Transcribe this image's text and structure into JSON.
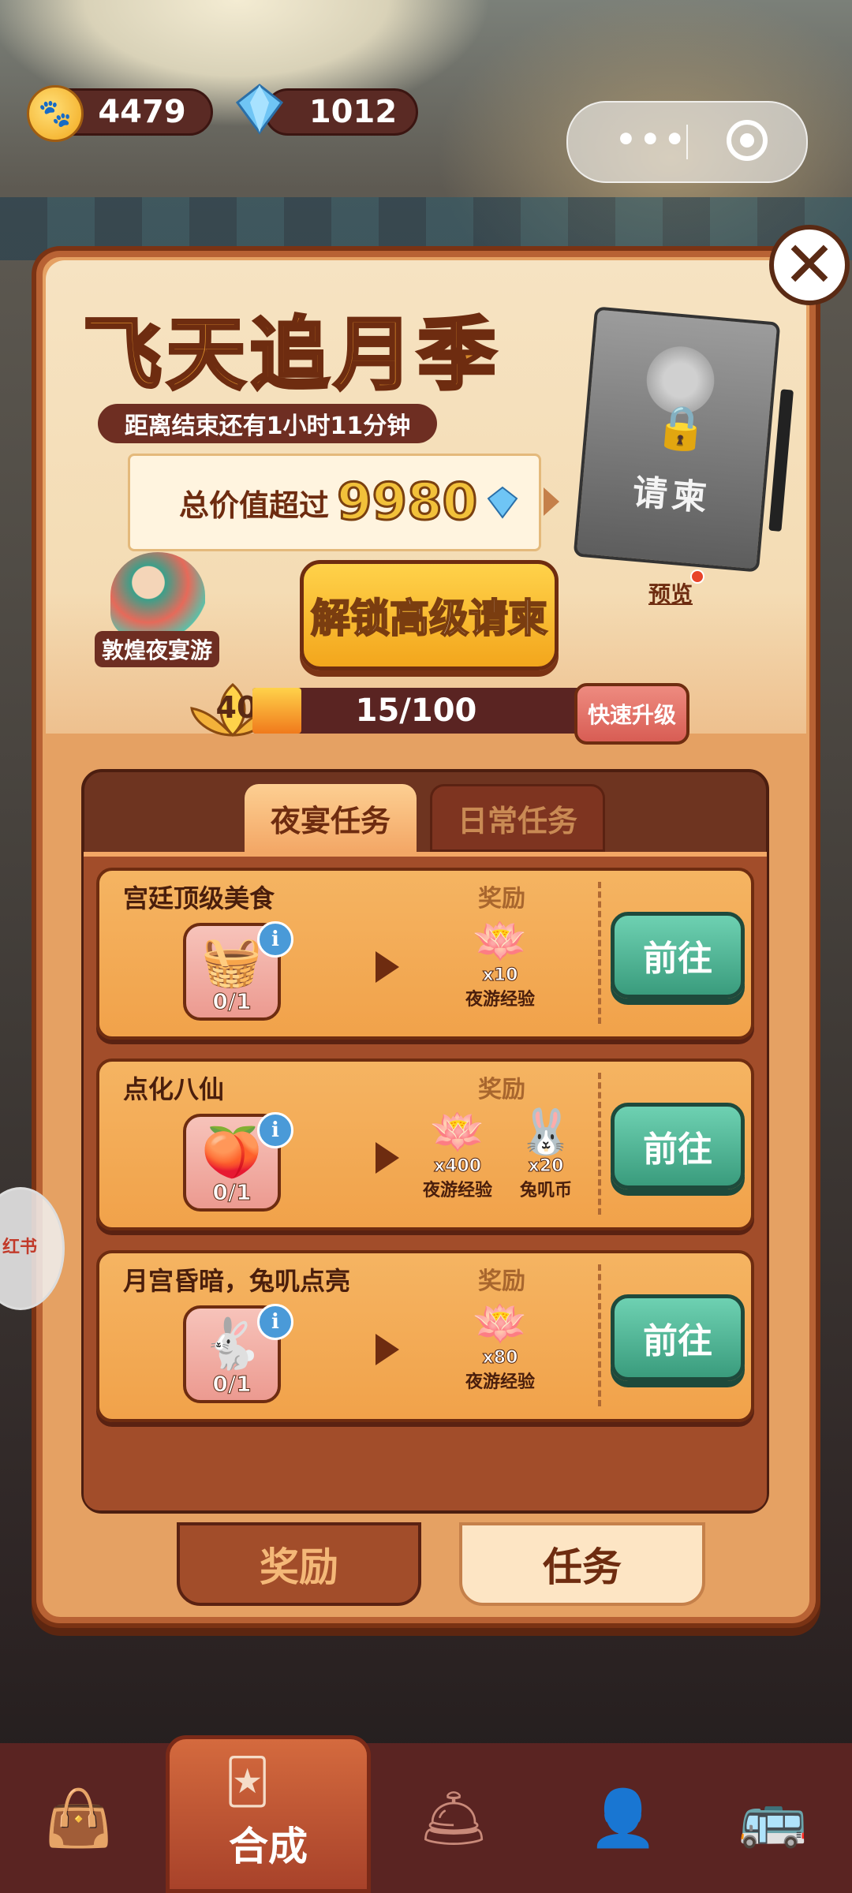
{
  "currency": {
    "paw": "4479",
    "gem": "1012"
  },
  "capsule": {
    "more_icon": "more-dots-icon",
    "close_icon": "target-circle-icon"
  },
  "season": {
    "title": "飞天追月季",
    "countdown": "距离结束还有1小时11分钟",
    "value_label": "总价值超过",
    "value_num": "9980",
    "unlock_button": "解锁高级请柬",
    "character_label": "敦煌夜宴游",
    "card_text": "请柬",
    "preview_label": "预览"
  },
  "level": {
    "num": "40",
    "progress_text": "15/100",
    "progress_fraction": 0.15,
    "quick_button": "快速升级"
  },
  "tabs": {
    "active": "夜宴任务",
    "inactive": "日常任务"
  },
  "reward_label": "奖励",
  "go_label": "前往",
  "tasks": [
    {
      "title": "宫廷顶级美食",
      "count": "0/1",
      "icon": "food-box-icon",
      "rewards": [
        {
          "icon": "lotus-icon",
          "qty": "x10",
          "name": "夜游经验"
        }
      ]
    },
    {
      "title": "点化八仙",
      "count": "0/1",
      "icon": "peach-icon",
      "rewards": [
        {
          "icon": "lotus-icon",
          "qty": "x400",
          "name": "夜游经验"
        },
        {
          "icon": "rabbit-coin-icon",
          "qty": "x20",
          "name": "兔叽币"
        }
      ]
    },
    {
      "title": "月宫昏暗，兔叽点亮",
      "count": "0/1",
      "icon": "rabbit-character-icon",
      "rewards": [
        {
          "icon": "lotus-icon",
          "qty": "x80",
          "name": "夜游经验"
        }
      ]
    }
  ],
  "panel_tabs": {
    "reward": "奖励",
    "task": "任务"
  },
  "side_widget": "红书",
  "bottom_nav": {
    "active_label": "合成"
  },
  "colors": {
    "go_button": "#3a9c7d",
    "panel": "#e5a163",
    "title_gold": "#d4892a"
  }
}
